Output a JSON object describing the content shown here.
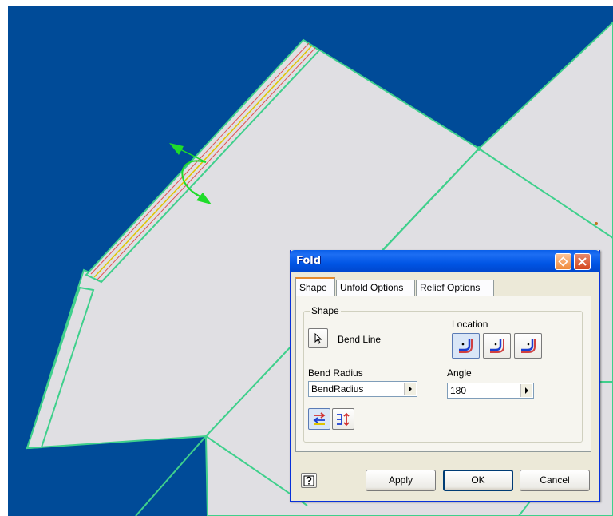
{
  "dialog": {
    "title": "Fold",
    "tabs": [
      {
        "label": "Shape",
        "active": true
      },
      {
        "label": "Unfold Options",
        "active": false
      },
      {
        "label": "Relief Options",
        "active": false
      }
    ],
    "shape_group_label": "Shape",
    "bend_line_label": "Bend Line",
    "location_label": "Location",
    "bend_radius_label": "Bend Radius",
    "bend_radius_value": "BendRadius",
    "angle_label": "Angle",
    "angle_value": "180",
    "buttons": {
      "apply": "Apply",
      "ok": "OK",
      "cancel": "Cancel"
    }
  },
  "icons": [
    "pin-icon",
    "close-icon",
    "select-arrow-icon",
    "bend-location-left-icon",
    "bend-location-center-icon",
    "bend-location-right-icon",
    "flip-side-icon",
    "flip-direction-icon",
    "help-icon",
    "combo-arrow-icon",
    "fold-direction-arrow-icon"
  ],
  "colors": {
    "viewport_background": "#004b98",
    "part_face": "#e0dfe3",
    "edge": "#3fd08c",
    "bend_line_centre": "#e0c400",
    "bend_line_outer": "#e05050",
    "title_bar": "#0055e5",
    "dialog_face": "#ece9d8"
  }
}
